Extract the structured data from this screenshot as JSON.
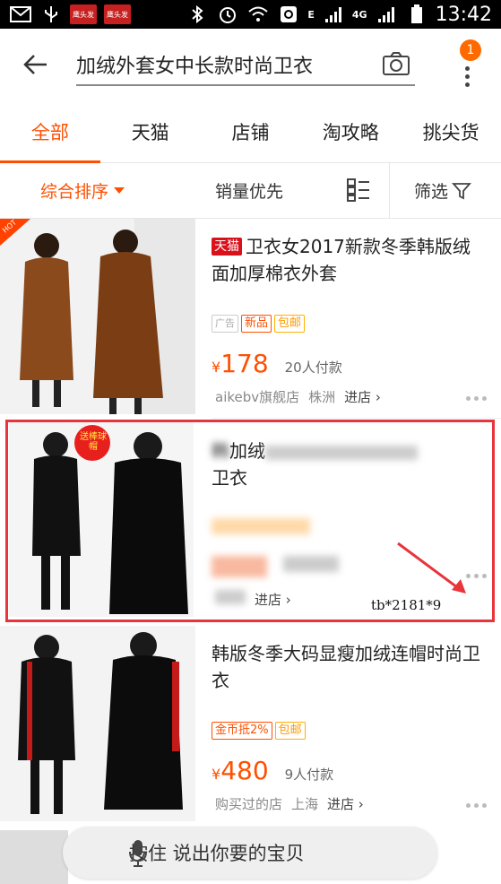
{
  "status_bar": {
    "time": "13:42",
    "network": "4G",
    "app1": "鹰头发",
    "app2": "鹰头发",
    "signal_e": "E"
  },
  "header": {
    "search_query": "加绒外套女中长款时尚卫衣",
    "cart_badge": "1"
  },
  "tabs": [
    {
      "label": "全部",
      "active": true
    },
    {
      "label": "天猫",
      "active": false
    },
    {
      "label": "店铺",
      "active": false
    },
    {
      "label": "淘攻略",
      "active": false
    },
    {
      "label": "挑尖货",
      "active": false
    }
  ],
  "sort": {
    "default": "综合排序",
    "sales": "销量优先",
    "filter": "筛选"
  },
  "products": [
    {
      "badge": "天猫",
      "title": "卫衣女2017新款冬季韩版绒面加厚棉衣外套",
      "tags": [
        "广告",
        "新品",
        "包邮"
      ],
      "price_symbol": "¥",
      "price": "178",
      "sold": "20人付款",
      "shop": "aikebv旗舰店",
      "location": "株洲",
      "enter": "进店 ›",
      "hot_label": "HOT"
    },
    {
      "title_visible_start": "韩",
      "title_visible_mid": "加绒",
      "title_line2": "卫衣",
      "enter": "进店 ›",
      "promo_sticker": "送棒球帽",
      "watermark": "tb*2181*9"
    },
    {
      "title": "韩版冬季大码显瘦加绒连帽时尚卫衣",
      "tags": [
        "金币抵2%",
        "包邮"
      ],
      "price_symbol": "¥",
      "price": "480",
      "sold": "9人付款",
      "shop": "购买过的店",
      "location": "上海",
      "enter": "进店 ›"
    }
  ],
  "voice_bar": {
    "label": "按住 说出你要的宝贝"
  },
  "colors": {
    "accent": "#ff5000",
    "tmall": "#d9111b",
    "highlight": "#e8343c"
  }
}
